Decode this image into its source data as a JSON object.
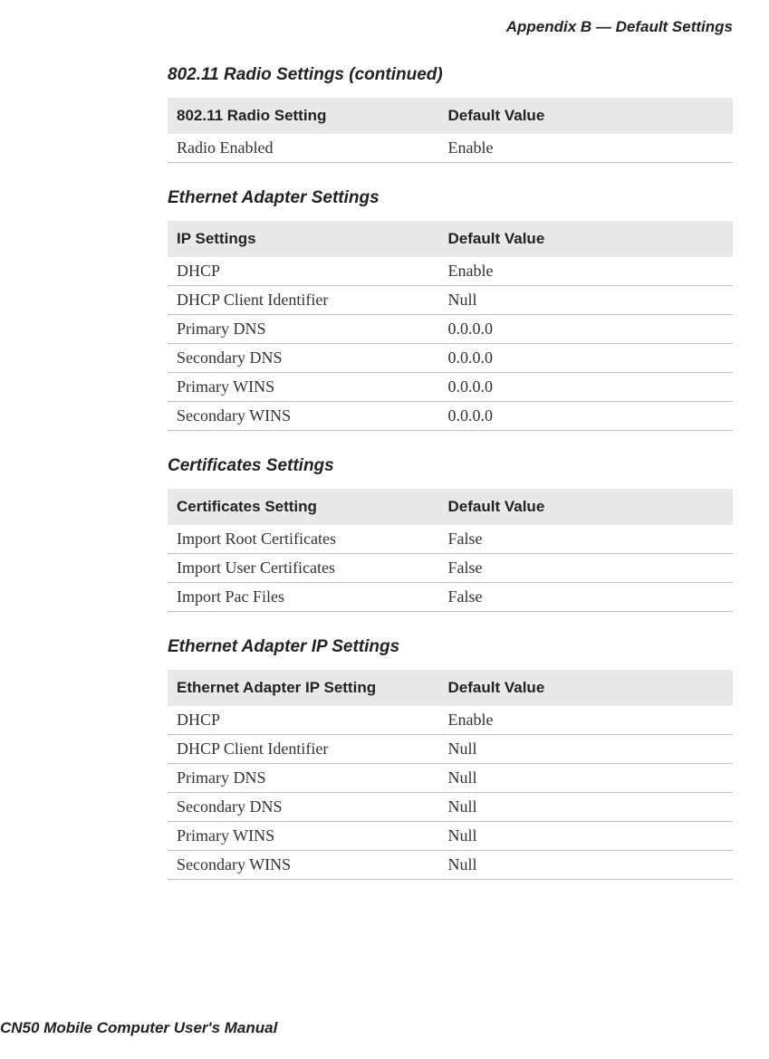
{
  "header": "Appendix B — Default Settings",
  "footer": "CN50 Mobile Computer User's Manual",
  "sections": [
    {
      "title": "802.11 Radio Settings (continued)",
      "col1": "802.11 Radio Setting",
      "col2": "Default Value",
      "rows": [
        {
          "name": "Radio Enabled",
          "value": "Enable"
        }
      ]
    },
    {
      "title": "Ethernet Adapter Settings",
      "col1": "IP Settings",
      "col2": "Default Value",
      "rows": [
        {
          "name": "DHCP",
          "value": "Enable"
        },
        {
          "name": "DHCP Client Identifier",
          "value": "Null"
        },
        {
          "name": "Primary DNS",
          "value": "0.0.0.0"
        },
        {
          "name": "Secondary DNS",
          "value": "0.0.0.0"
        },
        {
          "name": "Primary WINS",
          "value": "0.0.0.0"
        },
        {
          "name": "Secondary WINS",
          "value": "0.0.0.0"
        }
      ]
    },
    {
      "title": "Certificates Settings",
      "col1": "Certificates Setting",
      "col2": "Default Value",
      "rows": [
        {
          "name": "Import Root Certificates",
          "value": "False"
        },
        {
          "name": "Import User Certificates",
          "value": "False"
        },
        {
          "name": "Import Pac Files",
          "value": "False"
        }
      ]
    },
    {
      "title": "Ethernet Adapter IP Settings",
      "col1": "Ethernet Adapter IP Setting",
      "col2": "Default Value",
      "rows": [
        {
          "name": "DHCP",
          "value": "Enable"
        },
        {
          "name": "DHCP Client Identifier",
          "value": "Null"
        },
        {
          "name": "Primary DNS",
          "value": "Null"
        },
        {
          "name": "Secondary DNS",
          "value": "Null"
        },
        {
          "name": "Primary WINS",
          "value": "Null"
        },
        {
          "name": "Secondary WINS",
          "value": "Null"
        }
      ]
    }
  ]
}
